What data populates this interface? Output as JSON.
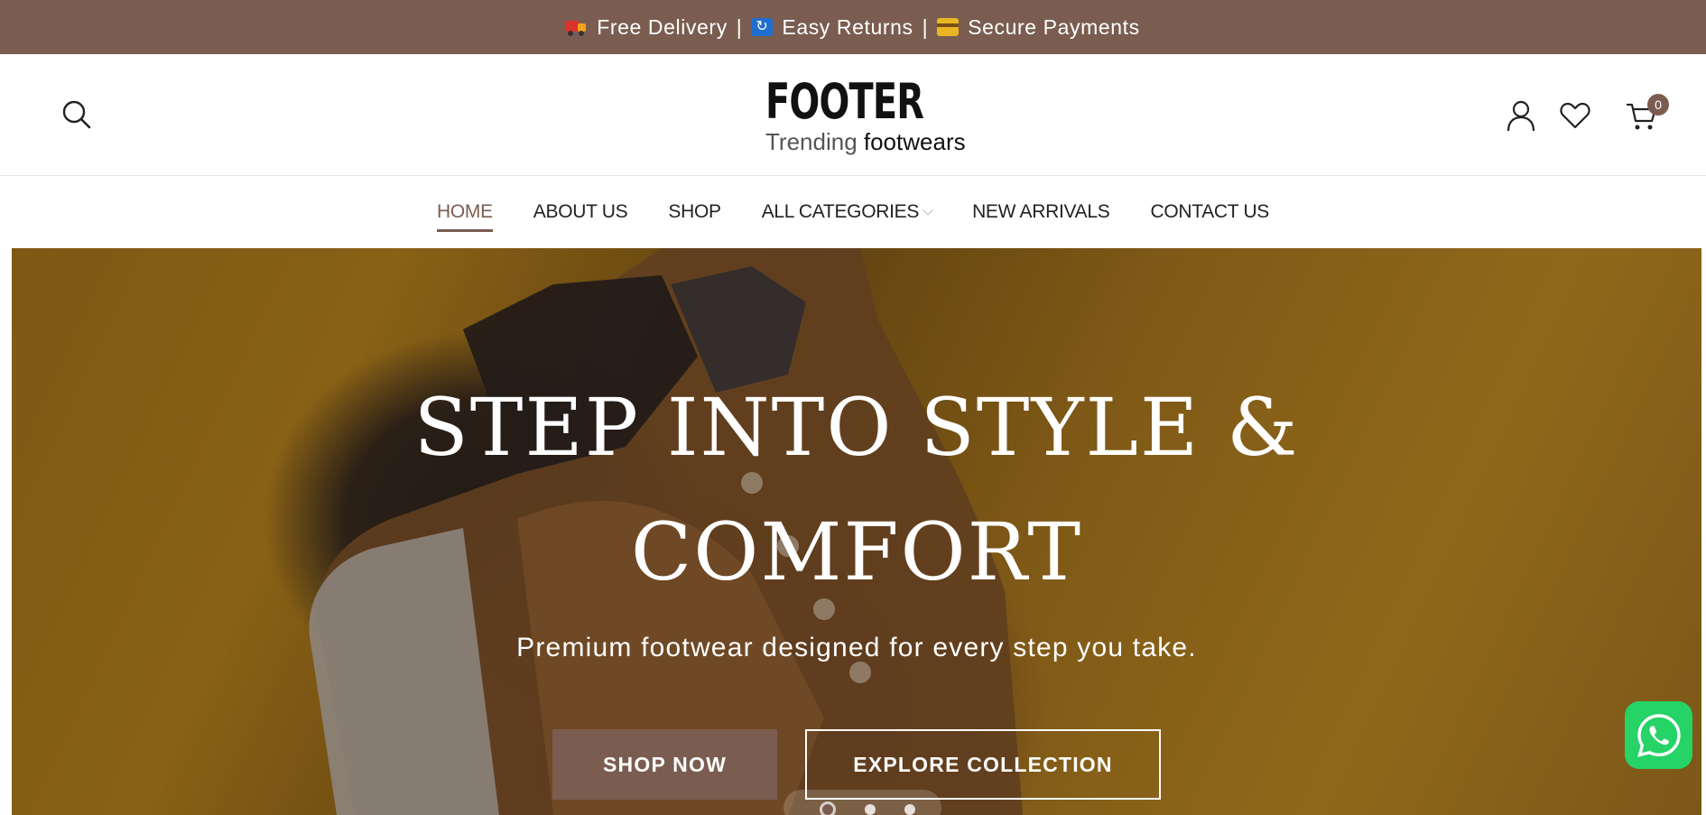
{
  "topbar": {
    "free_delivery": "Free Delivery",
    "easy_returns": "Easy Returns",
    "secure_payments": "Secure Payments",
    "separator": "|",
    "background": "#7a5d50"
  },
  "header": {
    "logo_word": "FOOTER",
    "logo_tagline_1": "Trending ",
    "logo_tagline_2": "footwears",
    "cart_count": "0",
    "icons": [
      "search-icon",
      "user-icon",
      "heart-icon",
      "cart-icon"
    ]
  },
  "nav": {
    "items": [
      {
        "label": "HOME",
        "active": true
      },
      {
        "label": "ABOUT US"
      },
      {
        "label": "SHOP"
      },
      {
        "label": "ALL CATEGORIES",
        "dropdown": true
      },
      {
        "label": "NEW ARRIVALS"
      },
      {
        "label": "CONTACT US"
      }
    ]
  },
  "hero": {
    "title_line1": "STEP INTO STYLE &",
    "title_line2": "COMFORT",
    "subtitle": "Premium footwear designed for every step you take.",
    "shop_button": "SHOP NOW",
    "explore_button": "EXPLORE COLLECTION",
    "slide_count": 3,
    "active_slide": 1
  },
  "colors": {
    "brand": "#7a5d50",
    "whatsapp": "#25d366"
  }
}
